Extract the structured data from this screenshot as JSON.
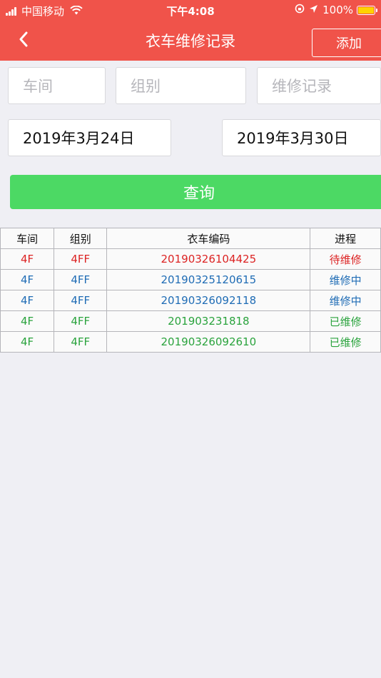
{
  "status_bar": {
    "carrier": "中国移动",
    "time": "下午4:08",
    "battery": "100%"
  },
  "header": {
    "title": "衣车维修记录",
    "add_label": "添加"
  },
  "filters": {
    "workshop_placeholder": "车间",
    "group_placeholder": "组别",
    "record_placeholder": "维修记录",
    "start_date": "2019年3月24日",
    "end_date": "2019年3月30日"
  },
  "query_label": "查询",
  "colors": {
    "header": "#f0534a",
    "query": "#4cd964",
    "pending": "#dc2323",
    "in_progress": "#1f6cb5",
    "done": "#2aa33d"
  },
  "table": {
    "headers": [
      "车间",
      "组别",
      "衣车编码",
      "进程"
    ],
    "rows": [
      {
        "workshop": "4F",
        "group": "4FF",
        "code": "20190326104425",
        "status": "待维修"
      },
      {
        "workshop": "4F",
        "group": "4FF",
        "code": "20190325120615",
        "status": "维修中"
      },
      {
        "workshop": "4F",
        "group": "4FF",
        "code": "20190326092118",
        "status": "维修中"
      },
      {
        "workshop": "4F",
        "group": "4FF",
        "code": "201903231818",
        "status": "已维修"
      },
      {
        "workshop": "4F",
        "group": "4FF",
        "code": "20190326092610",
        "status": "已维修"
      }
    ]
  }
}
